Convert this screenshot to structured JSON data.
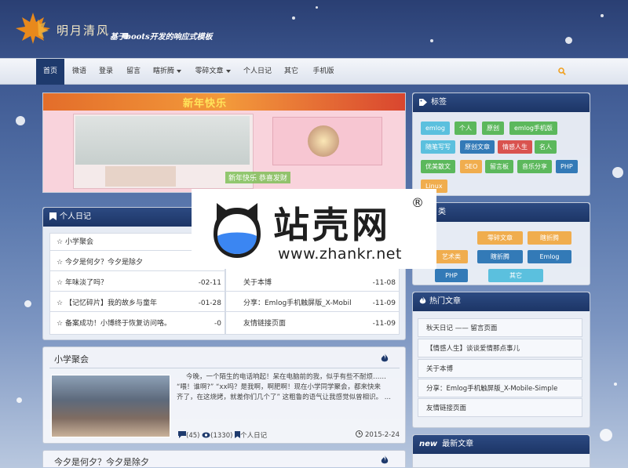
{
  "header": {
    "title": "明月清风",
    "subtitle": "基于boots开发的响应式模板"
  },
  "nav": {
    "items": [
      {
        "label": "首页",
        "active": true,
        "dropdown": false
      },
      {
        "label": "微语",
        "active": false,
        "dropdown": false
      },
      {
        "label": "登录",
        "active": false,
        "dropdown": false
      },
      {
        "label": "留言",
        "active": false,
        "dropdown": false
      },
      {
        "label": "瞎折腾",
        "active": false,
        "dropdown": true
      },
      {
        "label": "零碎文章",
        "active": false,
        "dropdown": true
      },
      {
        "label": "个人日记",
        "active": false,
        "dropdown": false
      },
      {
        "label": "其它",
        "active": false,
        "dropdown": false
      },
      {
        "label": "手机版",
        "active": false,
        "dropdown": false
      }
    ],
    "search_icon": "search-icon",
    "accent": "#f0a020",
    "active_bg": "#1e3a6d"
  },
  "slideshow": {
    "banner_text": "新年快乐",
    "caption_text": "新年快乐 恭喜发财"
  },
  "diary": {
    "title": "个人日记",
    "left": [
      {
        "text": "小学聚会",
        "date": "-0"
      },
      {
        "text": "今夕是何夕？今夕是除夕",
        "date": "-0"
      },
      {
        "text": "年味淡了吗？",
        "date": "-02-11"
      },
      {
        "text": "【记忆碎片】我的故乡与童年",
        "date": "-01-28"
      },
      {
        "text": "备案成功！小博终于恢复访问咯。",
        "date": "-0"
      }
    ],
    "right": [
      {
        "text": "关于本博",
        "date": "-11-08"
      },
      {
        "text": "分享：Emlog手机触屏版_X-Mobil",
        "date": "-11-09"
      },
      {
        "text": "友情链接页面",
        "date": "-11-09"
      }
    ]
  },
  "posts": [
    {
      "title": "小学聚会",
      "excerpt_1": "今晚，一个陌生的电话响起！呆在电脑前的我，似乎有些不耐烦……",
      "excerpt_2": "“喂！谁啊?”    “xx吗？是我啊，啊肥啊！现在小学同学聚会，都来快来",
      "excerpt_3": "齐了，在这烧烤，就差你们几个了”  这粗鲁的语气让我感觉似曾相识。 ...",
      "comments": "(45)",
      "views": "(1330)",
      "category": "个人日记",
      "date": "2015-2-24"
    },
    {
      "title": "今夕是何夕？今夕是除夕"
    }
  ],
  "tags": {
    "title": "标签",
    "items": [
      {
        "label": "emlog",
        "color": "#5bc0de"
      },
      {
        "label": "个人",
        "color": "#5cb85c"
      },
      {
        "label": "原创",
        "color": "#5cb85c"
      },
      {
        "label": "emlog手机版",
        "color": "#5cb85c"
      },
      {
        "label": "随笔写写",
        "color": "#5bc0de"
      },
      {
        "label": "原创文章",
        "color": "#337ab7"
      },
      {
        "label": "情感人生",
        "color": "#d9534f"
      },
      {
        "label": "名人",
        "color": "#5cb85c"
      },
      {
        "label": "优美散文",
        "color": "#5cb85c"
      },
      {
        "label": "SEO",
        "color": "#f0ad4e"
      },
      {
        "label": "留言板",
        "color": "#5cb85c"
      },
      {
        "label": "音乐分享",
        "color": "#5cb85c"
      },
      {
        "label": "PHP",
        "color": "#337ab7"
      },
      {
        "label": "Linux",
        "color": "#f0ad4e"
      }
    ]
  },
  "categories": {
    "title": "类",
    "items": [
      {
        "label": "零碎文章",
        "color": "#f0ad4e"
      },
      {
        "label": "瞎折腾",
        "color": "#f0ad4e"
      },
      {
        "label": "艺术类",
        "color": "#f0ad4e"
      },
      {
        "label": "瞎折腾",
        "color": "#337ab7"
      },
      {
        "label": "Emlog",
        "color": "#337ab7"
      },
      {
        "label": "PHP",
        "color": "#337ab7"
      },
      {
        "label": "其它",
        "color": "#5bc0de"
      }
    ]
  },
  "hot": {
    "title": "热门文章",
    "items": [
      "秋天日记 —— 留言页面",
      "【情感人生】谈谈爱情那点事儿",
      "关于本博",
      "分享：Emlog手机触屏版_X-Mobile-Simple",
      "友情链接页面"
    ]
  },
  "latest": {
    "badge": "new",
    "title": "最新文章"
  },
  "watermark": {
    "brand": "站壳网",
    "url": "www.zhankr.net",
    "registered": "®"
  }
}
